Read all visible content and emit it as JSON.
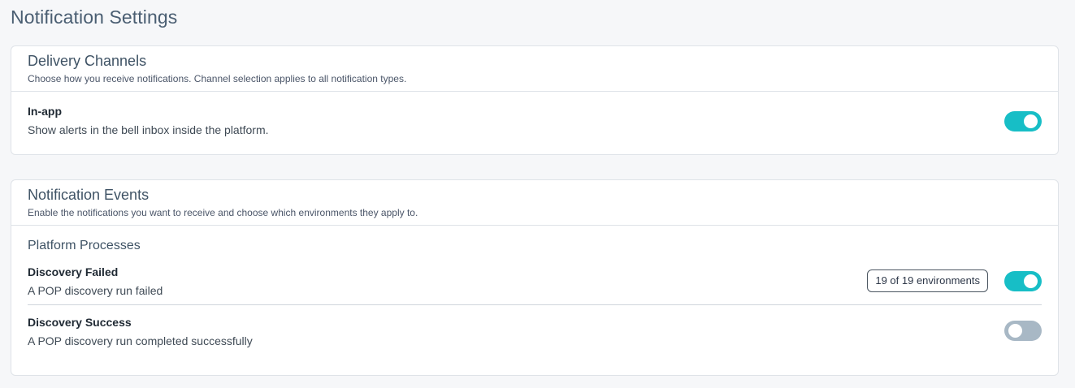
{
  "page": {
    "title": "Notification Settings"
  },
  "delivery": {
    "title": "Delivery Channels",
    "subtitle": "Choose how you receive notifications. Channel selection applies to all notification types.",
    "channels": [
      {
        "label": "In-app",
        "description": "Show alerts in the bell inbox inside the platform.",
        "enabled": true
      }
    ]
  },
  "events": {
    "title": "Notification Events",
    "subtitle": "Enable the notifications you want to receive and choose which environments they apply to.",
    "group": {
      "title": "Platform Processes",
      "items": [
        {
          "label": "Discovery Failed",
          "description": "A POP discovery run failed",
          "environments": "19 of 19 environments",
          "enabled": true
        },
        {
          "label": "Discovery Success",
          "description": "A POP discovery run completed successfully",
          "enabled": false
        }
      ]
    }
  },
  "colors": {
    "toggle_on": "#17bec6",
    "toggle_off": "#a8b8c5",
    "title_text": "#4a5e72"
  }
}
